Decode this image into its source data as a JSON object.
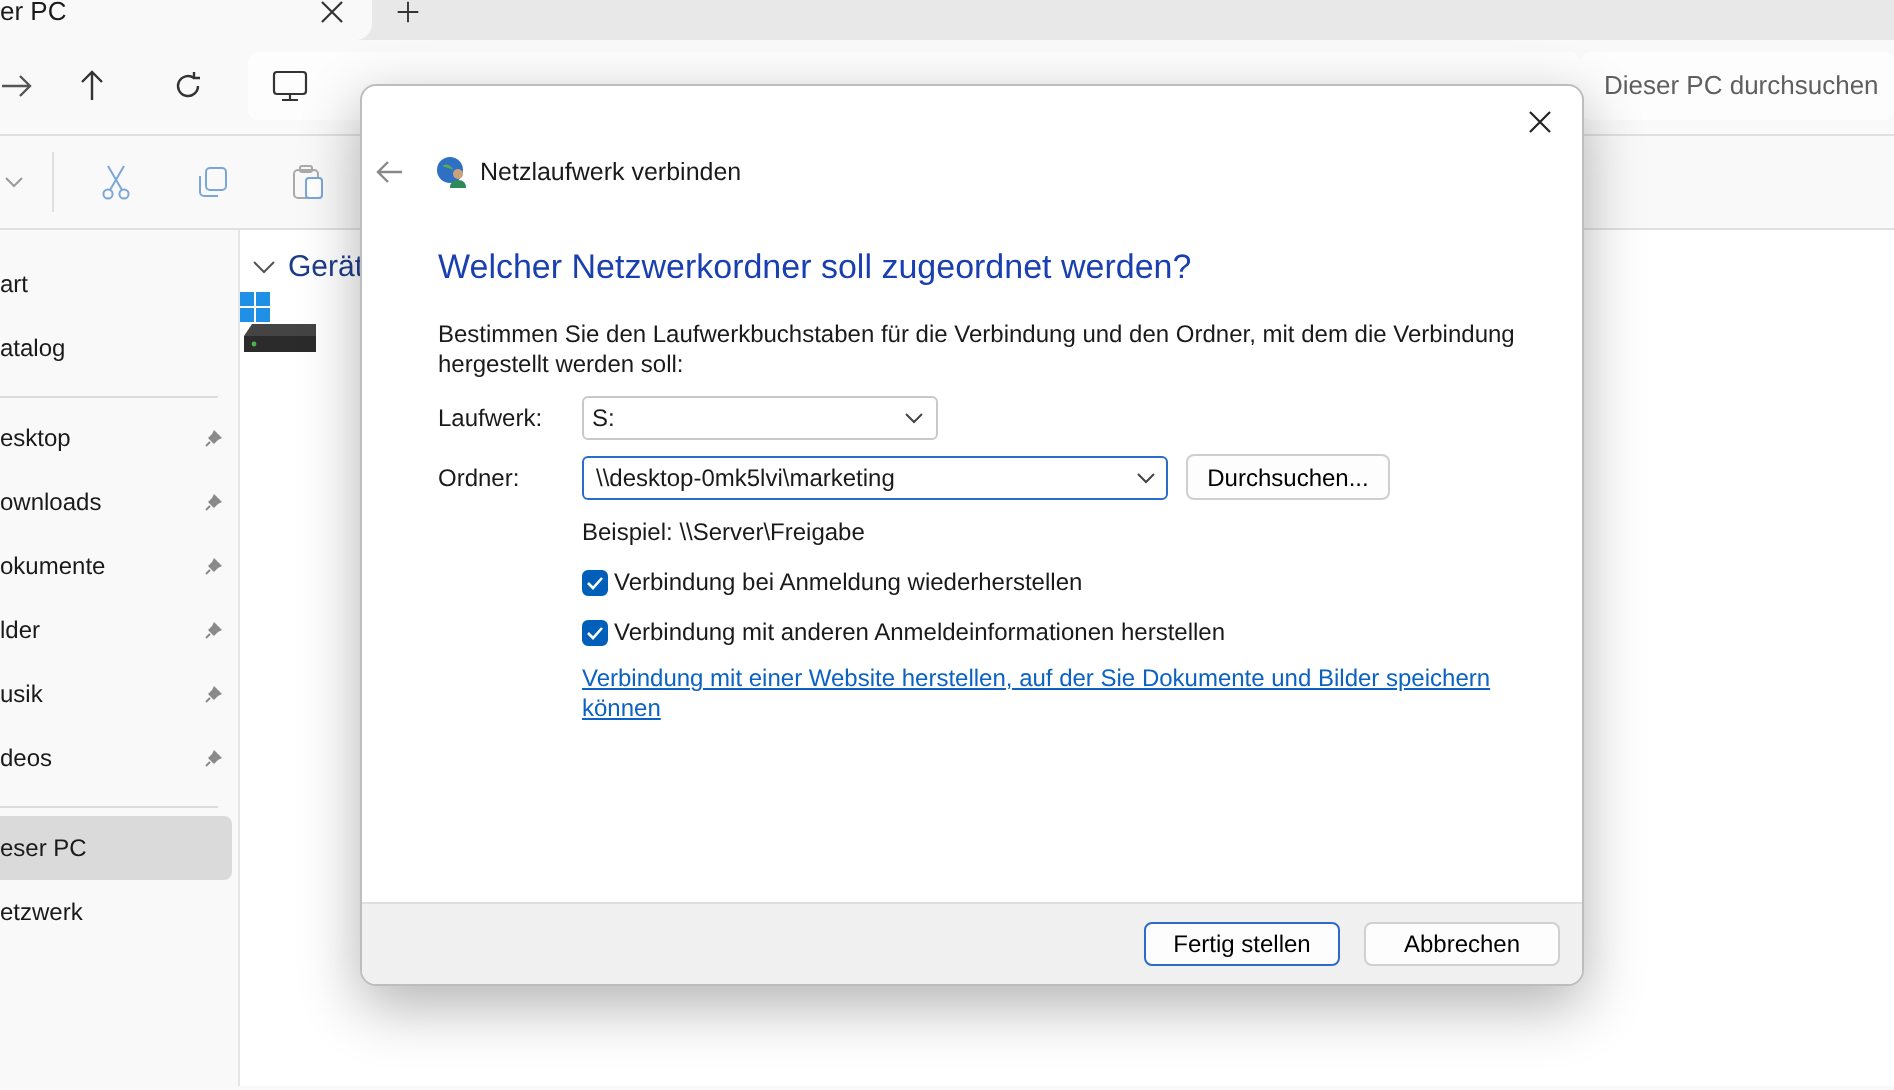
{
  "explorer": {
    "tab": {
      "title": "er PC"
    },
    "search": {
      "placeholder": "Dieser PC durchsuchen"
    },
    "sidebar": {
      "sections": [
        {
          "items": [
            {
              "label": "art",
              "pinned": false,
              "selected": false
            },
            {
              "label": "atalog",
              "pinned": false,
              "selected": false
            }
          ]
        },
        {
          "items": [
            {
              "label": "esktop",
              "pinned": true,
              "selected": false
            },
            {
              "label": "ownloads",
              "pinned": true,
              "selected": false
            },
            {
              "label": "okumente",
              "pinned": true,
              "selected": false
            },
            {
              "label": "lder",
              "pinned": true,
              "selected": false
            },
            {
              "label": "usik",
              "pinned": true,
              "selected": false
            },
            {
              "label": "deos",
              "pinned": true,
              "selected": false
            }
          ]
        },
        {
          "items": [
            {
              "label": "eser PC",
              "pinned": false,
              "selected": true
            },
            {
              "label": "etzwerk",
              "pinned": false,
              "selected": false
            }
          ]
        }
      ]
    },
    "content": {
      "group_heading": "Gerät"
    }
  },
  "dialog": {
    "title": "Netzlaufwerk verbinden",
    "heading": "Welcher Netzwerkordner soll zugeordnet werden?",
    "description": "Bestimmen Sie den Laufwerkbuchstaben für die Verbindung und den Ordner, mit dem die Verbindung hergestellt werden soll:",
    "fields": [
      {
        "label": "Laufwerk:",
        "value": "S:",
        "focused": false
      },
      {
        "label": "Ordner:",
        "value": "\\\\desktop-0mk5lvi\\marketing",
        "focused": true,
        "button": "Durchsuchen..."
      }
    ],
    "example": "Beispiel: \\\\Server\\Freigabe",
    "checkboxes": [
      {
        "label": "Verbindung bei Anmeldung wiederherstellen",
        "checked": true
      },
      {
        "label": "Verbindung mit anderen Anmeldeinformationen herstellen",
        "checked": true
      }
    ],
    "link": "Verbindung mit einer Website herstellen, auf der Sie Dokumente und Bilder speichern können",
    "buttons": [
      {
        "label": "Fertig stellen",
        "default": true
      },
      {
        "label": "Abbrechen",
        "default": false
      }
    ]
  }
}
